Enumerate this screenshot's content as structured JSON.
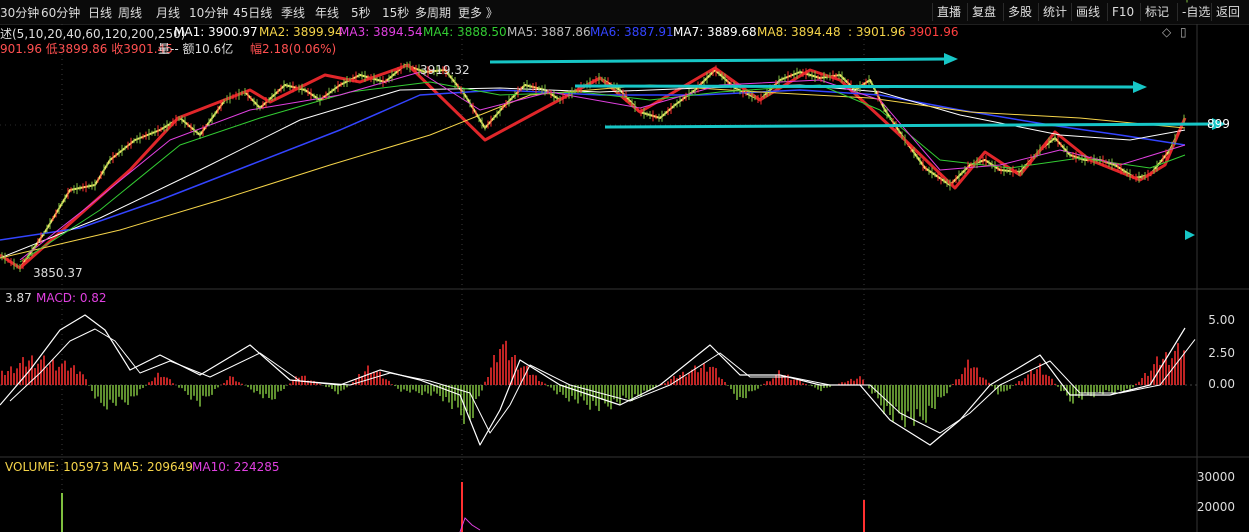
{
  "toolbar": {
    "periods": [
      "30分钟",
      "60分钟",
      "日线",
      "周线",
      "月线",
      "10分钟",
      "45日线",
      "季线",
      "年线",
      "5秒",
      "15秒",
      "多周期",
      "更多 》"
    ],
    "right_buttons": [
      "直播",
      "复盘",
      "多股",
      "统计",
      "画线",
      "F10",
      "标记",
      "-自选",
      "返回"
    ]
  },
  "ma_line": {
    "label": "述(5,10,20,40,60,120,200,250)",
    "items": [
      {
        "name": "MA1",
        "value": "3900.97",
        "color": "#ffffff"
      },
      {
        "name": "MA2",
        "value": "3899.94",
        "color": "#f5d44a"
      },
      {
        "name": "MA3",
        "value": "3894.54",
        "color": "#e040e0"
      },
      {
        "name": "MA4",
        "value": "3888.50",
        "color": "#33cc33"
      },
      {
        "name": "MA5",
        "value": "3887.86",
        "color": "#bbbbbb"
      },
      {
        "name": "MA6",
        "value": "3887.91",
        "color": "#3344ff"
      },
      {
        "name": "MA7",
        "value": "3889.68",
        "color": "#ffffff"
      },
      {
        "name": "MA8",
        "value": "3894.48",
        "color": "#f5d44a"
      }
    ],
    "extra1": ": 3901.96",
    "extra2": ": 3901.96"
  },
  "quote_line": {
    "text_red": "901.96 低3899.86 收3901.45",
    "vol_text": "量-- 额10.6亿",
    "amp_text": "幅2.18(0.06%)"
  },
  "price_labels": {
    "high": "3919.32",
    "low": "3850.37",
    "right": "899"
  },
  "macd": {
    "label_a": "3.87",
    "label_b": "MACD: 0.82",
    "axis": [
      "5.00",
      "2.50",
      "0.00"
    ]
  },
  "volume": {
    "label": "VOLUME: 105973",
    "ma5": "MA5: 209649",
    "ma10": "MA10: 224285",
    "axis": [
      "30000",
      "20000"
    ]
  },
  "colors": {
    "up": "#ff3030",
    "down": "#7fbf3f",
    "arrow": "#17c6c6",
    "trend": "#e0262a",
    "zig": "#f2e36a"
  }
}
